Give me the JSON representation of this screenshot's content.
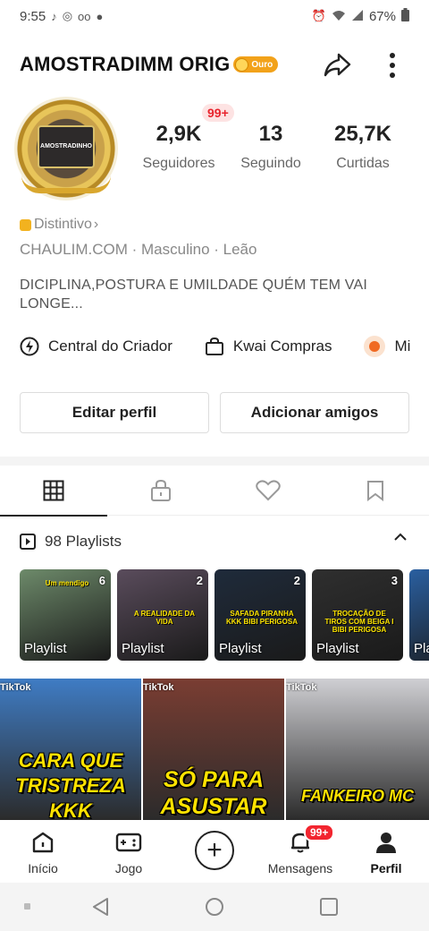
{
  "status_bar": {
    "time": "9:55",
    "battery": "67%"
  },
  "header": {
    "name": "AMOSTRADIMM ORIG",
    "badge": "Ouro"
  },
  "avatar": {
    "text": "AMOSTRADINHO"
  },
  "notification_badge": "99+",
  "stats": [
    {
      "value": "2,9K",
      "label": "Seguidores"
    },
    {
      "value": "13",
      "label": "Seguindo"
    },
    {
      "value": "25,7K",
      "label": "Curtidas"
    }
  ],
  "distintivo": "Distintivo",
  "info_line": "CHAULIM.COM · Masculino · Leão",
  "bio": "DICIPLINA,POSTURA E UMILDADE QUÉM TEM VAI LONGE...",
  "quick_links": [
    "Central do Criador",
    "Kwai Compras",
    "Mi"
  ],
  "buttons": {
    "edit": "Editar perfil",
    "add": "Adicionar amigos"
  },
  "playlists": {
    "header": "98 Playlists",
    "items": [
      {
        "label": "Playlist",
        "count": "6",
        "caption": "Um mendigo",
        "color": "#6d8a6a"
      },
      {
        "label": "Playlist",
        "count": "2",
        "caption": "A REALIDADE DA VIDA",
        "color": "#5a4c5c"
      },
      {
        "label": "Playlist",
        "count": "2",
        "caption": "SAFADA PIRANHA KKK BIBI PERIGOSA",
        "color": "#1f2b3b"
      },
      {
        "label": "Playlist",
        "count": "3",
        "caption": "TROCAÇÃO DE TIROS COM BEIGA I BIBI PERIGOSA",
        "color": "#2f2f2f"
      },
      {
        "label": "Pla",
        "count": "",
        "caption": "",
        "color": "#2a5fa0"
      }
    ]
  },
  "videos": [
    {
      "caption": "CARA QUE TRISTREZA KKK",
      "logo": "TikTok",
      "color": "#3f7cc4"
    },
    {
      "caption": "SÓ PARA ASUSTAR",
      "logo": "TikTok",
      "color": "#7a3d32"
    },
    {
      "caption": "FANKEIRO MC",
      "logo": "TikTok",
      "color": "#cfcfd3"
    }
  ],
  "bottom_nav": [
    {
      "label": "Início"
    },
    {
      "label": "Jogo"
    },
    {
      "label": ""
    },
    {
      "label": "Mensagens",
      "badge": "99+"
    },
    {
      "label": "Perfil"
    }
  ]
}
